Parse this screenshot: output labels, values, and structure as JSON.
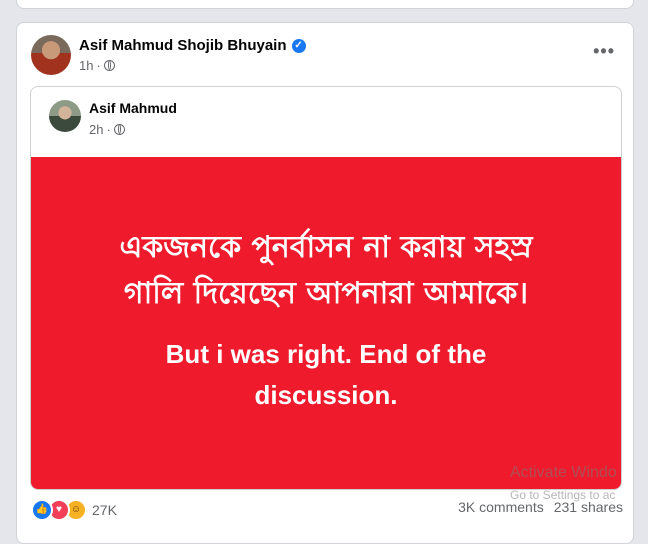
{
  "post": {
    "author": "Asif Mahmud Shojib Bhuyain",
    "time": "1h",
    "separator": "·",
    "more_label": "•••"
  },
  "shared_post": {
    "author": "Asif Mahmud",
    "time": "2h",
    "separator": "·",
    "banner_color": "#ef1b2c",
    "bangla_line_1": "একজনকে পুনর্বাসন না করায় সহস্র",
    "bangla_line_2": "গালি দিয়েছেন আপনারা আমাকে।",
    "english_line_1": "But i was right. End of the",
    "english_line_2": "discussion."
  },
  "footer": {
    "reaction_count": "27K",
    "comments": "3K comments",
    "shares": "231 shares",
    "reaction_icons": [
      "like-icon",
      "love-icon",
      "haha-icon"
    ]
  },
  "watermark": {
    "line_1": "Activate Windo",
    "line_2": "Go to Settings to ac"
  }
}
